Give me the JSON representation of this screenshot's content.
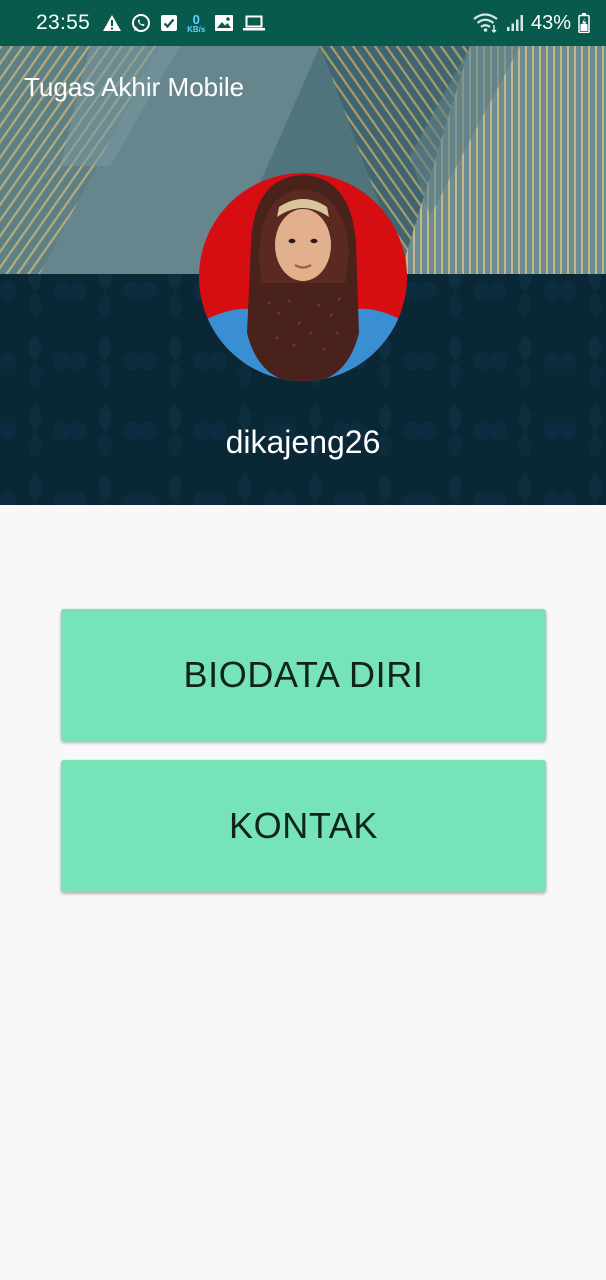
{
  "status_bar": {
    "time": "23:55",
    "net_speed_value": "0",
    "net_speed_unit": "KB/s",
    "battery": "43%",
    "icons_left": [
      "warning-icon",
      "whatsapp-icon",
      "checkbox-icon",
      "net-speed-indicator",
      "gallery-icon",
      "laptop-icon"
    ],
    "icons_right": [
      "wifi-icon",
      "signal-icon",
      "battery-icon"
    ]
  },
  "header": {
    "title": "Tugas Akhir Mobile",
    "username": "dikajeng26"
  },
  "buttons": {
    "biodata_label": "BIODATA DIRI",
    "kontak_label": "KONTAK"
  },
  "colors": {
    "status_bar": "#075a4c",
    "header_dark": "#0d2a3a",
    "button_green": "#76e4b8",
    "page_background": "#f8f8f8"
  }
}
